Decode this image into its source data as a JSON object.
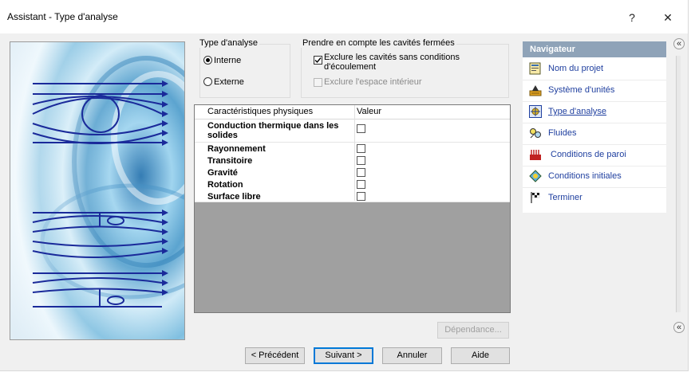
{
  "window": {
    "title": "Assistant - Type d'analyse",
    "help_label": "?",
    "close_label": "✕"
  },
  "analysis_type": {
    "group_label": "Type d'analyse",
    "options": [
      {
        "label": "Interne",
        "selected": true
      },
      {
        "label": "Externe",
        "selected": false
      }
    ]
  },
  "cavities": {
    "group_label": "Prendre en compte les cavités fermées",
    "options": [
      {
        "label_line1": "Exclure les cavités sans conditions",
        "label_line2": "d'écoulement",
        "checked": true,
        "enabled": true
      },
      {
        "label": "Exclure l'espace intérieur",
        "checked": false,
        "enabled": false
      }
    ]
  },
  "physics_table": {
    "col_name": "Caractéristiques physiques",
    "col_value": "Valeur",
    "rows": [
      {
        "line1": "Conduction thermique dans les",
        "line2": "solides",
        "checked": false
      },
      {
        "label": "Rayonnement",
        "checked": false
      },
      {
        "label": "Transitoire",
        "checked": false
      },
      {
        "label": "Gravité",
        "checked": false
      },
      {
        "label": "Rotation",
        "checked": false
      },
      {
        "label": "Surface libre",
        "checked": false
      }
    ]
  },
  "buttons": {
    "dependance": "Dépendance...",
    "previous": "< Précédent",
    "next": "Suivant >",
    "cancel": "Annuler",
    "help": "Aide"
  },
  "navigator": {
    "title": "Navigateur",
    "collapse_label": "«",
    "items": [
      {
        "label": "Nom du projet",
        "icon": "project-name-icon",
        "active": false
      },
      {
        "label": "Système d'unités",
        "icon": "unit-system-icon",
        "active": false
      },
      {
        "label": "Type d'analyse",
        "icon": "analysis-type-icon",
        "active": true
      },
      {
        "label": "Fluides",
        "icon": "fluids-icon",
        "active": false
      },
      {
        "label": "Conditions de paroi",
        "icon": "wall-conditions-icon",
        "active": false
      },
      {
        "label": "Conditions initiales",
        "icon": "initial-conditions-icon",
        "active": false
      },
      {
        "label": "Terminer",
        "icon": "finish-flag-icon",
        "active": false
      }
    ]
  },
  "colors": {
    "nav_header": "#8fa3b8",
    "nav_link": "#1f3f9f",
    "flow_lines": "#1a2a9a",
    "default_button_border": "#0078d7"
  }
}
